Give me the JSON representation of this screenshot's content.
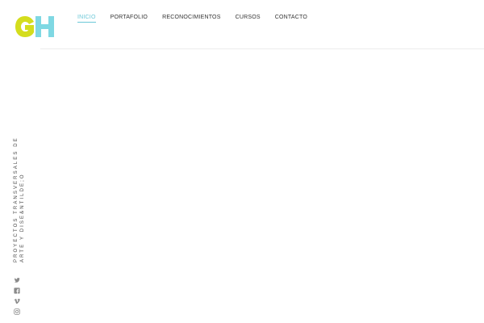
{
  "brand": {
    "logo_text": "GH",
    "colors": {
      "g": "#d4dd1d",
      "h": "#7fd8e3"
    }
  },
  "nav": {
    "items": [
      {
        "label": "INICIO",
        "active": true
      },
      {
        "label": "PORTAFOLIO",
        "active": false
      },
      {
        "label": "RECONOCIMIENTOS",
        "active": false
      },
      {
        "label": "CURSOS",
        "active": false
      },
      {
        "label": "CONTACTO",
        "active": false
      }
    ],
    "active_color": "#6cc8d8"
  },
  "sidebar": {
    "tagline": "PROYECTOS TRANSVERSALES DE ARTE Y DISE&NTILDE;O",
    "social": [
      {
        "icon": "twitter-icon"
      },
      {
        "icon": "facebook-icon"
      },
      {
        "icon": "vimeo-icon"
      },
      {
        "icon": "instagram-icon"
      }
    ]
  }
}
